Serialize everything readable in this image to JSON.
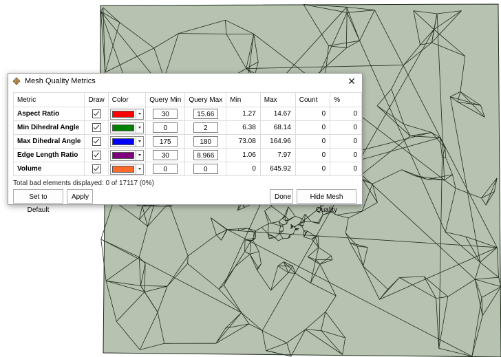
{
  "window": {
    "title": "Mesh Quality Metrics",
    "close_glyph": "✕"
  },
  "table": {
    "headers": [
      "Metric",
      "Draw",
      "Color",
      "Query Min",
      "Query Max",
      "Min",
      "Max",
      "Count",
      "%"
    ],
    "rows": [
      {
        "metric": "Aspect Ratio",
        "draw": true,
        "color": "#ff0000",
        "query_min": "30",
        "query_max": "15.66",
        "min": "1.27",
        "max": "14.67",
        "count": "0",
        "pct": "0"
      },
      {
        "metric": "Min Dihedral Angle",
        "draw": true,
        "color": "#008000",
        "query_min": "0",
        "query_max": "2",
        "min": "6.38",
        "max": "68.14",
        "count": "0",
        "pct": "0"
      },
      {
        "metric": "Max Dihedral Angle",
        "draw": true,
        "color": "#0000ff",
        "query_min": "175",
        "query_max": "180",
        "min": "73.08",
        "max": "164.96",
        "count": "0",
        "pct": "0"
      },
      {
        "metric": "Edge Length Ratio",
        "draw": true,
        "color": "#800080",
        "query_min": "30",
        "query_max": "8.966",
        "min": "1.06",
        "max": "7.97",
        "count": "0",
        "pct": "0"
      },
      {
        "metric": "Volume",
        "draw": true,
        "color": "#ff6a2a",
        "query_min": "0",
        "query_max": "0",
        "min": "0",
        "max": "645.92",
        "count": "0",
        "pct": "0"
      }
    ]
  },
  "status_text": "Total bad elements displayed: 0 of 17117 (0%)",
  "buttons": {
    "set_default": "Set to Default",
    "apply": "Apply",
    "done": "Done",
    "hide_mesh": "Hide Mesh Quality"
  },
  "colors": {
    "mesh_fill": "#b7c2b1",
    "mesh_edge": "#1e2a1c"
  }
}
